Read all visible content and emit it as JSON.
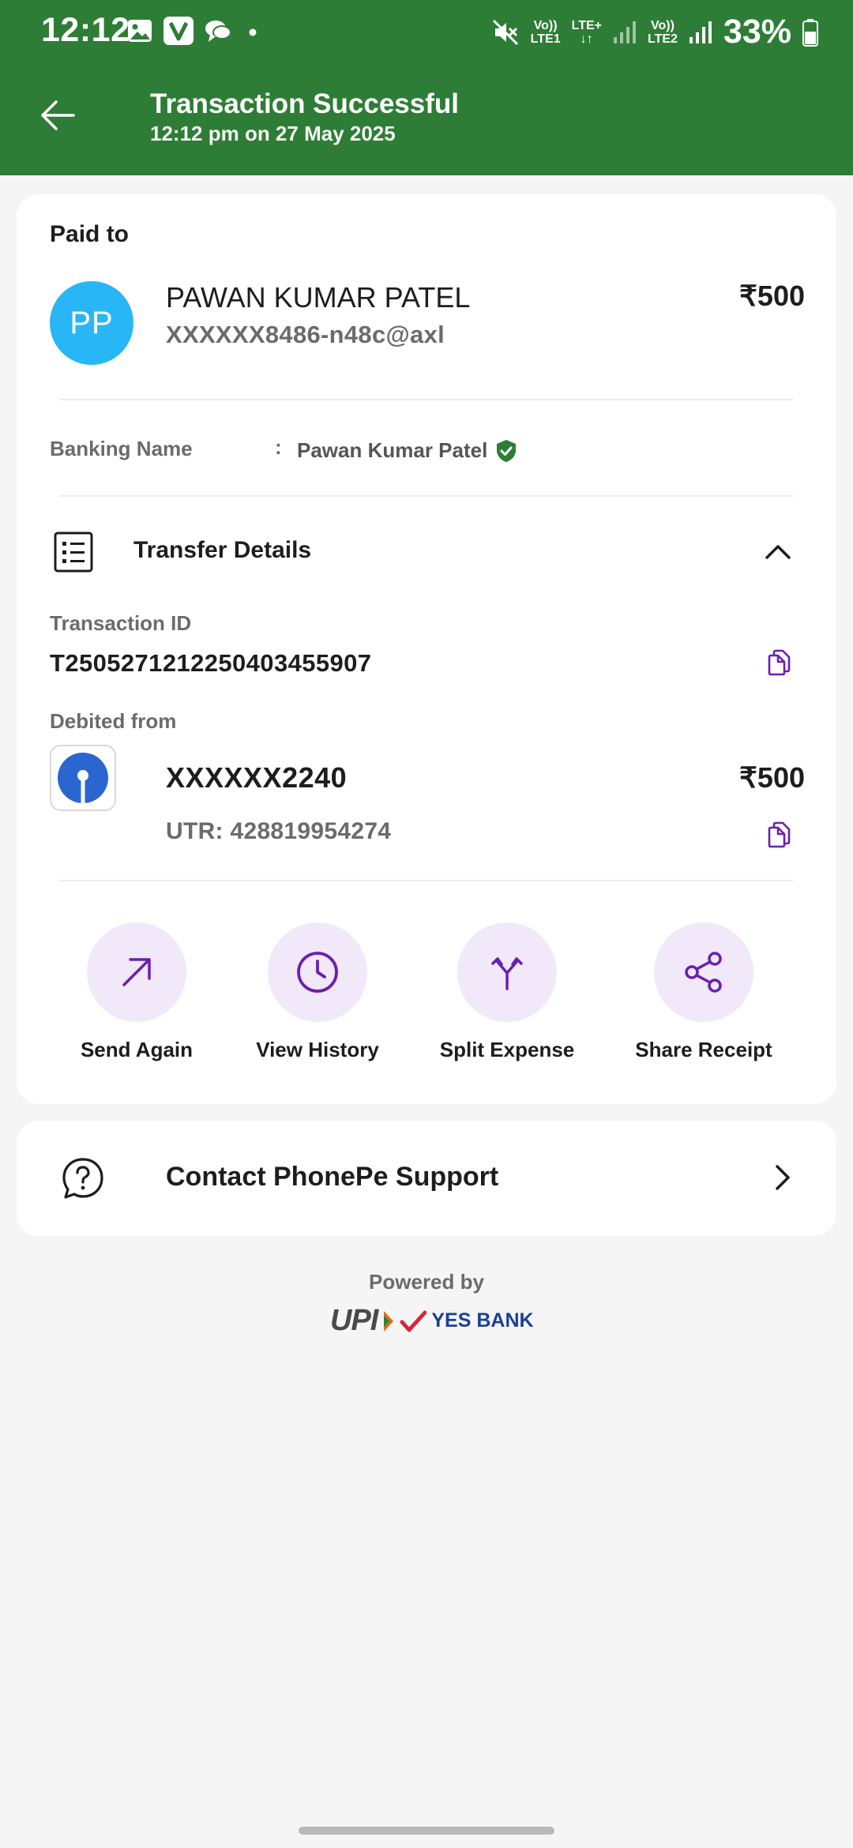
{
  "status_bar": {
    "time": "12:12",
    "net1_top": "Vo))",
    "net1_bottom": "LTE1",
    "net_mid_top": "LTE+",
    "net_mid_bottom": "↓↑",
    "net2_top": "Vo))",
    "net2_bottom": "LTE2",
    "battery": "33%"
  },
  "header": {
    "title": "Transaction Successful",
    "subtitle": "12:12 pm on 27 May 2025",
    "bg_color": "#2e7d36"
  },
  "payee": {
    "section_label": "Paid to",
    "initials": "PP",
    "name": "PAWAN KUMAR PATEL",
    "vpa": "XXXXXX8486-n48c@axl",
    "amount": "₹500"
  },
  "banking_name": {
    "label": "Banking Name",
    "separator": ":",
    "value": "Pawan Kumar Patel"
  },
  "transfer_details": {
    "title": "Transfer Details",
    "transaction_id_label": "Transaction ID",
    "transaction_id": "T2505271212250403455907",
    "debited_from_label": "Debited from",
    "account": "XXXXXX2240",
    "account_amount": "₹500",
    "utr": "UTR: 428819954274"
  },
  "actions": [
    {
      "label": "Send Again",
      "icon": "arrow-up-right-icon"
    },
    {
      "label": "View History",
      "icon": "clock-icon"
    },
    {
      "label": "Split Expense",
      "icon": "split-icon"
    },
    {
      "label": "Share Receipt",
      "icon": "share-icon"
    }
  ],
  "support": {
    "label": "Contact PhonePe Support"
  },
  "footer": {
    "powered_by": "Powered by",
    "upi_logo_text": "UPI",
    "bank_logo_text": "YES BANK"
  },
  "colors": {
    "accent_purple": "#6a1fb0",
    "action_bg": "#f1e8fa",
    "verified_green": "#2e7d36"
  }
}
